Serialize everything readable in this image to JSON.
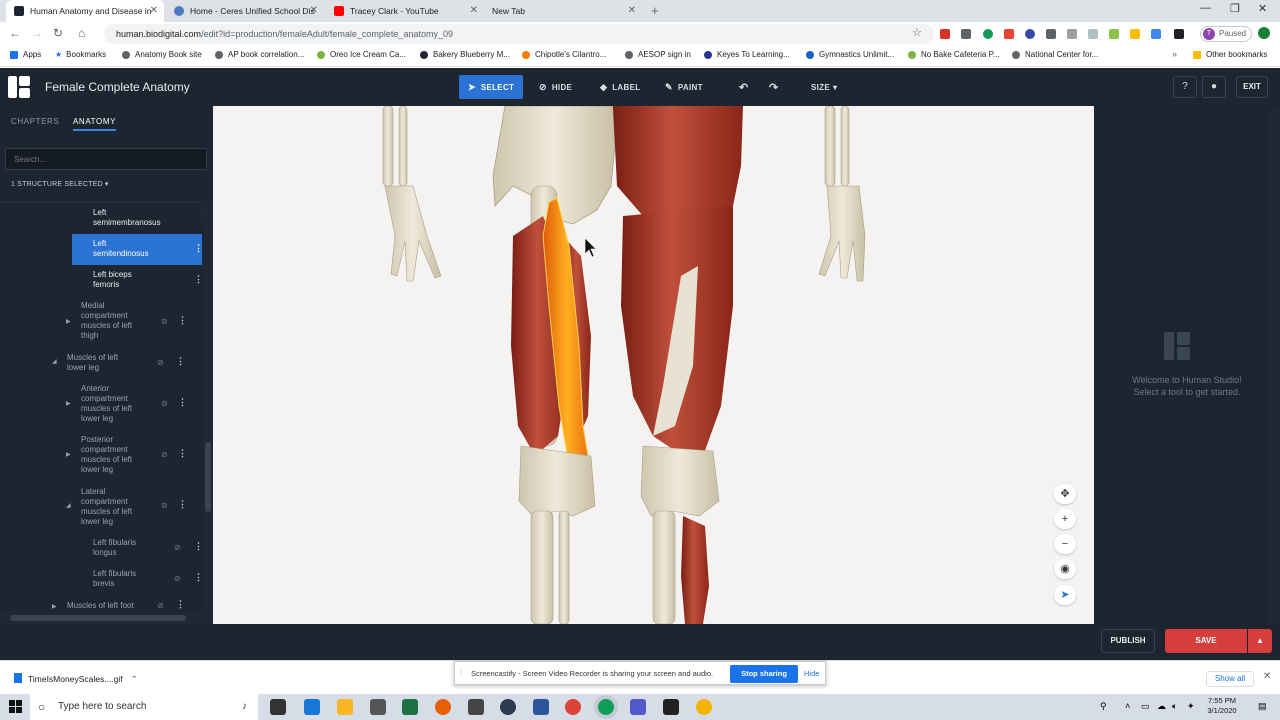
{
  "browser": {
    "tabs": [
      {
        "title": "Human Anatomy and Disease in",
        "favicon_color": "#1d2530"
      },
      {
        "title": "Home - Ceres Unified School Dis",
        "favicon_color": "#4a7bbf"
      },
      {
        "title": "Tracey Clark - YouTube",
        "favicon_color": "#ff0000"
      },
      {
        "title": "New Tab",
        "favicon_color": "#ffffff"
      }
    ],
    "url_domain": "human.biodigital.com",
    "url_path": "/edit?id=production/femaleAdult/female_complete_anatomy_09",
    "profile_initial": "T",
    "profile_status": "Paused",
    "bookmarks": [
      {
        "label": "Apps",
        "color": "#1a73e8"
      },
      {
        "label": "Bookmarks",
        "color": "#1a73e8"
      },
      {
        "label": "Anatomy Book site",
        "color": "#5f6368"
      },
      {
        "label": "AP book correlation...",
        "color": "#5f6368"
      },
      {
        "label": "Oreo Ice Cream Ca...",
        "color": "#7cb342"
      },
      {
        "label": "Bakery Blueberry M...",
        "color": "#1d2530"
      },
      {
        "label": "Chipotle's Cilantro...",
        "color": "#f57c00"
      },
      {
        "label": "AESOP sign in",
        "color": "#5f6368"
      },
      {
        "label": "Keyes To Learning...",
        "color": "#283593"
      },
      {
        "label": "Gymnastics Unlimit...",
        "color": "#1565c0"
      },
      {
        "label": "No Bake Cafeteria P...",
        "color": "#7cb342"
      },
      {
        "label": "National Center for...",
        "color": "#5f6368"
      }
    ],
    "other_bookmarks": "Other bookmarks"
  },
  "app": {
    "title": "Female Complete Anatomy",
    "tools": {
      "select": "SELECT",
      "hide": "HIDE",
      "label": "LABEL",
      "paint": "PAINT"
    },
    "size": "SIZE",
    "help": "?",
    "exit": "EXIT",
    "accent": "#2a72d4"
  },
  "sidebar": {
    "tabs": [
      "CHAPTERS",
      "ANATOMY"
    ],
    "active_tab": "ANATOMY",
    "search_placeholder": "Search...",
    "selection": "1 STRUCTURE SELECTED",
    "tree": [
      {
        "label": "Left semimembranosus"
      },
      {
        "label": "Left semitendinosus",
        "selected": true
      },
      {
        "label": "Left biceps femoris"
      },
      {
        "label": "Medial compartment muscles of left thigh"
      },
      {
        "label": "Muscles of left lower leg"
      },
      {
        "label": "Anterior compartment muscles of left lower leg"
      },
      {
        "label": "Posterior compartment muscles of left lower leg"
      },
      {
        "label": "Lateral compartment muscles of left lower leg"
      },
      {
        "label": "Left fibularis longus"
      },
      {
        "label": "Left fibularis brevis"
      },
      {
        "label": "Muscles of left foot"
      }
    ]
  },
  "welcome": {
    "line1": "Welcome to Human Studio!",
    "line2": "Select a tool to get started."
  },
  "bottom": {
    "publish": "PUBLISH",
    "save": "SAVE",
    "save_color": "#d63d3d"
  },
  "downloads": {
    "file": "TimeIsMoneyScales....gif",
    "show_all": "Show all"
  },
  "screencastify": {
    "message": "Screencastify - Screen Video Recorder is sharing your screen and audio.",
    "stop": "Stop sharing",
    "hide": "Hide"
  },
  "taskbar": {
    "search": "Type here to search",
    "time": "7:55 PM",
    "date": "3/1/2020"
  }
}
